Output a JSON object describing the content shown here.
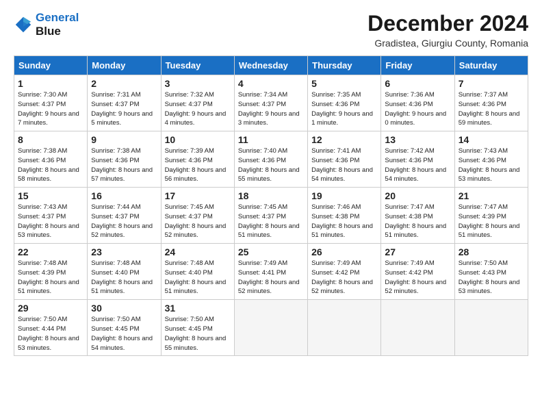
{
  "logo": {
    "line1": "General",
    "line2": "Blue"
  },
  "title": "December 2024",
  "subtitle": "Gradistea, Giurgiu County, Romania",
  "headers": [
    "Sunday",
    "Monday",
    "Tuesday",
    "Wednesday",
    "Thursday",
    "Friday",
    "Saturday"
  ],
  "weeks": [
    [
      {
        "day": "1",
        "rise": "7:30 AM",
        "set": "4:37 PM",
        "daylight": "9 hours and 7 minutes."
      },
      {
        "day": "2",
        "rise": "7:31 AM",
        "set": "4:37 PM",
        "daylight": "9 hours and 5 minutes."
      },
      {
        "day": "3",
        "rise": "7:32 AM",
        "set": "4:37 PM",
        "daylight": "9 hours and 4 minutes."
      },
      {
        "day": "4",
        "rise": "7:34 AM",
        "set": "4:37 PM",
        "daylight": "9 hours and 3 minutes."
      },
      {
        "day": "5",
        "rise": "7:35 AM",
        "set": "4:36 PM",
        "daylight": "9 hours and 1 minute."
      },
      {
        "day": "6",
        "rise": "7:36 AM",
        "set": "4:36 PM",
        "daylight": "9 hours and 0 minutes."
      },
      {
        "day": "7",
        "rise": "7:37 AM",
        "set": "4:36 PM",
        "daylight": "8 hours and 59 minutes."
      }
    ],
    [
      {
        "day": "8",
        "rise": "7:38 AM",
        "set": "4:36 PM",
        "daylight": "8 hours and 58 minutes."
      },
      {
        "day": "9",
        "rise": "7:38 AM",
        "set": "4:36 PM",
        "daylight": "8 hours and 57 minutes."
      },
      {
        "day": "10",
        "rise": "7:39 AM",
        "set": "4:36 PM",
        "daylight": "8 hours and 56 minutes."
      },
      {
        "day": "11",
        "rise": "7:40 AM",
        "set": "4:36 PM",
        "daylight": "8 hours and 55 minutes."
      },
      {
        "day": "12",
        "rise": "7:41 AM",
        "set": "4:36 PM",
        "daylight": "8 hours and 54 minutes."
      },
      {
        "day": "13",
        "rise": "7:42 AM",
        "set": "4:36 PM",
        "daylight": "8 hours and 54 minutes."
      },
      {
        "day": "14",
        "rise": "7:43 AM",
        "set": "4:36 PM",
        "daylight": "8 hours and 53 minutes."
      }
    ],
    [
      {
        "day": "15",
        "rise": "7:43 AM",
        "set": "4:37 PM",
        "daylight": "8 hours and 53 minutes."
      },
      {
        "day": "16",
        "rise": "7:44 AM",
        "set": "4:37 PM",
        "daylight": "8 hours and 52 minutes."
      },
      {
        "day": "17",
        "rise": "7:45 AM",
        "set": "4:37 PM",
        "daylight": "8 hours and 52 minutes."
      },
      {
        "day": "18",
        "rise": "7:45 AM",
        "set": "4:37 PM",
        "daylight": "8 hours and 51 minutes."
      },
      {
        "day": "19",
        "rise": "7:46 AM",
        "set": "4:38 PM",
        "daylight": "8 hours and 51 minutes."
      },
      {
        "day": "20",
        "rise": "7:47 AM",
        "set": "4:38 PM",
        "daylight": "8 hours and 51 minutes."
      },
      {
        "day": "21",
        "rise": "7:47 AM",
        "set": "4:39 PM",
        "daylight": "8 hours and 51 minutes."
      }
    ],
    [
      {
        "day": "22",
        "rise": "7:48 AM",
        "set": "4:39 PM",
        "daylight": "8 hours and 51 minutes."
      },
      {
        "day": "23",
        "rise": "7:48 AM",
        "set": "4:40 PM",
        "daylight": "8 hours and 51 minutes."
      },
      {
        "day": "24",
        "rise": "7:48 AM",
        "set": "4:40 PM",
        "daylight": "8 hours and 51 minutes."
      },
      {
        "day": "25",
        "rise": "7:49 AM",
        "set": "4:41 PM",
        "daylight": "8 hours and 52 minutes."
      },
      {
        "day": "26",
        "rise": "7:49 AM",
        "set": "4:42 PM",
        "daylight": "8 hours and 52 minutes."
      },
      {
        "day": "27",
        "rise": "7:49 AM",
        "set": "4:42 PM",
        "daylight": "8 hours and 52 minutes."
      },
      {
        "day": "28",
        "rise": "7:50 AM",
        "set": "4:43 PM",
        "daylight": "8 hours and 53 minutes."
      }
    ],
    [
      {
        "day": "29",
        "rise": "7:50 AM",
        "set": "4:44 PM",
        "daylight": "8 hours and 53 minutes."
      },
      {
        "day": "30",
        "rise": "7:50 AM",
        "set": "4:45 PM",
        "daylight": "8 hours and 54 minutes."
      },
      {
        "day": "31",
        "rise": "7:50 AM",
        "set": "4:45 PM",
        "daylight": "8 hours and 55 minutes."
      },
      null,
      null,
      null,
      null
    ]
  ],
  "labels": {
    "sunrise": "Sunrise:",
    "sunset": "Sunset:",
    "daylight": "Daylight:"
  }
}
